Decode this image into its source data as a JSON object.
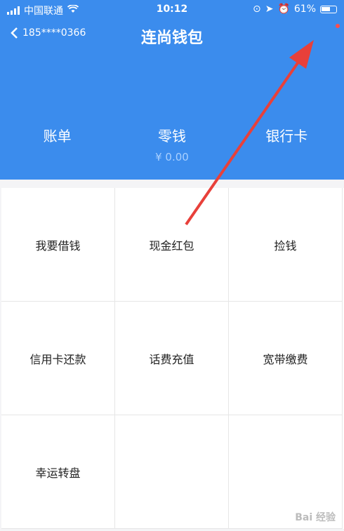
{
  "status": {
    "carrier": "中国联通",
    "time": "10:12",
    "battery": "61%"
  },
  "nav": {
    "back_text": "185****0366",
    "title": "连尚钱包"
  },
  "tabs": [
    {
      "label": "账单"
    },
    {
      "label": "零钱",
      "sub": "¥ 0.00"
    },
    {
      "label": "银行卡"
    }
  ],
  "grid": [
    [
      "我要借钱",
      "现金红包",
      "捡钱"
    ],
    [
      "信用卡还款",
      "话费充值",
      "宽带缴费"
    ],
    [
      "幸运转盘",
      "",
      ""
    ]
  ],
  "colors": {
    "header_bg": "#3b8ced",
    "arrow": "#e8403a"
  },
  "watermark": "Bai 经验"
}
